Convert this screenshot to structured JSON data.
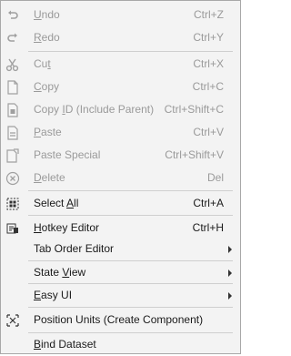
{
  "menu": {
    "items": [
      {
        "pre": "",
        "ul": "U",
        "post": "ndo",
        "shortcut": "Ctrl+Z",
        "icon": "undo-icon",
        "disabled": true
      },
      {
        "pre": "",
        "ul": "R",
        "post": "edo",
        "shortcut": "Ctrl+Y",
        "icon": "redo-icon",
        "disabled": true
      },
      {
        "pre": "Cu",
        "ul": "t",
        "post": "",
        "shortcut": "Ctrl+X",
        "icon": "scissors-icon",
        "disabled": true
      },
      {
        "pre": "",
        "ul": "C",
        "post": "opy",
        "shortcut": "Ctrl+C",
        "icon": "copy-icon",
        "disabled": true
      },
      {
        "pre": "Copy ",
        "ul": "I",
        "post": "D (Include Parent)",
        "shortcut": "Ctrl+Shift+C",
        "icon": "copy-id-icon",
        "disabled": true
      },
      {
        "pre": "",
        "ul": "P",
        "post": "aste",
        "shortcut": "Ctrl+V",
        "icon": "paste-icon",
        "disabled": true
      },
      {
        "pre": "Paste Special",
        "ul": "",
        "post": "",
        "shortcut": "Ctrl+Shift+V",
        "icon": "paste-special-icon",
        "disabled": true
      },
      {
        "pre": "",
        "ul": "D",
        "post": "elete",
        "shortcut": "Del",
        "icon": "delete-icon",
        "disabled": true
      },
      {
        "pre": "Select ",
        "ul": "A",
        "post": "ll",
        "shortcut": "Ctrl+A",
        "icon": "select-all-icon",
        "disabled": false
      },
      {
        "pre": "",
        "ul": "H",
        "post": "otkey Editor",
        "shortcut": "Ctrl+H",
        "icon": "hotkey-editor-icon",
        "disabled": false
      },
      {
        "pre": "Tab Order Editor",
        "ul": "",
        "post": "",
        "shortcut": "",
        "icon": "",
        "disabled": false,
        "submenu": true
      },
      {
        "pre": "State ",
        "ul": "V",
        "post": "iew",
        "shortcut": "",
        "icon": "",
        "disabled": false,
        "submenu": true
      },
      {
        "pre": "",
        "ul": "E",
        "post": "asy UI",
        "shortcut": "",
        "icon": "",
        "disabled": false,
        "submenu": true
      },
      {
        "pre": "Position Units (Create Component)",
        "ul": "",
        "post": "",
        "shortcut": "",
        "icon": "position-units-icon",
        "disabled": false
      },
      {
        "pre": "",
        "ul": "B",
        "post": "ind Dataset",
        "shortcut": "",
        "icon": "",
        "disabled": false
      }
    ]
  }
}
